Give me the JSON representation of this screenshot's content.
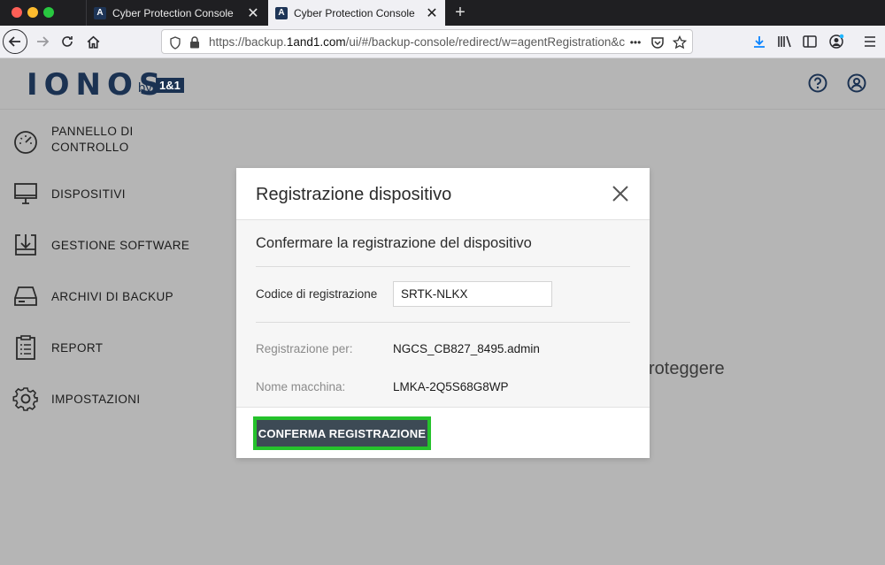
{
  "browser": {
    "tabs": [
      {
        "label": "Cyber Protection Console",
        "favicon": "A",
        "active": false
      },
      {
        "label": "Cyber Protection Console",
        "favicon": "A",
        "active": true
      }
    ],
    "new_tab_label": "+",
    "url_prefix": "https://backup.",
    "url_domain": "1and1.com",
    "url_rest": "/ui/#/backup-console/redirect/w=agentRegistration&c",
    "more_label": "•••"
  },
  "app": {
    "logo_text": "IONOS",
    "logo_by": "by",
    "logo_brand": "1&1"
  },
  "sidebar": {
    "items": [
      {
        "label": "PANNELLO DI CONTROLLO",
        "icon": "dashboard-gauge-icon"
      },
      {
        "label": "DISPOSITIVI",
        "icon": "monitor-icon"
      },
      {
        "label": "GESTIONE SOFTWARE",
        "icon": "software-download-icon"
      },
      {
        "label": "ARCHIVI DI BACKUP",
        "icon": "drive-icon"
      },
      {
        "label": "REPORT",
        "icon": "clipboard-icon"
      },
      {
        "label": "IMPOSTAZIONI",
        "icon": "gear-icon"
      }
    ]
  },
  "background_text": "roteggere",
  "modal": {
    "title": "Registrazione dispositivo",
    "subtitle": "Confermare la registrazione del dispositivo",
    "code_label": "Codice di registrazione",
    "code_value": "SRTK-NLKX",
    "registration_for_label": "Registrazione per:",
    "registration_for_value": "NGCS_CB827_8495.admin",
    "machine_name_label": "Nome macchina:",
    "machine_name_value": "LMKA-2Q5S68G8WP",
    "confirm_button": "CONFERMA REGISTRAZIONE"
  },
  "colors": {
    "brand": "#1b3252",
    "confirm_button": "#3d4a55",
    "highlight": "#25c22c",
    "overlay": "#b5b5b5"
  }
}
